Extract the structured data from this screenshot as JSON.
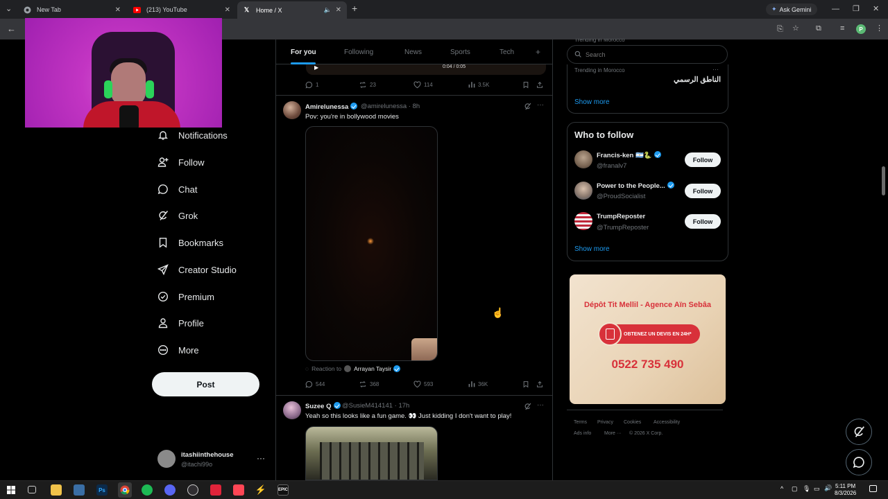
{
  "browser": {
    "tabs": [
      {
        "title": "New Tab",
        "icon": "chrome-icon"
      },
      {
        "title": "(213) YouTube",
        "icon": "youtube-icon"
      },
      {
        "title": "Home / X",
        "icon": "x-logo-icon"
      }
    ],
    "ask_gemini": "Ask Gemini",
    "profile_letter": "P"
  },
  "nav": {
    "items": [
      {
        "label": "Notifications",
        "icon": "bell-icon"
      },
      {
        "label": "Follow",
        "icon": "person-add-icon"
      },
      {
        "label": "Chat",
        "icon": "chat-bubble-icon"
      },
      {
        "label": "Grok",
        "icon": "grok-icon"
      },
      {
        "label": "Bookmarks",
        "icon": "bookmark-icon"
      },
      {
        "label": "Creator Studio",
        "icon": "rocket-icon"
      },
      {
        "label": "Premium",
        "icon": "verified-badge-icon"
      },
      {
        "label": "Profile",
        "icon": "person-icon"
      },
      {
        "label": "More",
        "icon": "more-circle-icon"
      }
    ],
    "post_label": "Post",
    "account": {
      "name": "itashiinthehouse",
      "handle": "@itachi99o"
    }
  },
  "timeline": {
    "tabs": [
      "For you",
      "Following",
      "News",
      "Sports",
      "Tech"
    ],
    "video_time": "0:04 / 0:05",
    "prev_tweet_actions": {
      "replies": "1",
      "reposts": "23",
      "likes": "114",
      "views": "3.5K"
    },
    "tweet1": {
      "name": "Amirelunessa",
      "handle": "@amirelunessa",
      "time": "8h",
      "text": "Pov: you're in bollywood movies",
      "reaction_prefix": "Reaction to",
      "reaction_name": "Arrayan Taysir",
      "actions": {
        "replies": "544",
        "reposts": "368",
        "likes": "593",
        "views": "36K"
      }
    },
    "tweet2": {
      "name": "Suzee Q",
      "handle": "@SusieM414141",
      "time": "17h",
      "text": "Yeah so this looks like a fun game. 👀 Just kidding I don't want to play!"
    }
  },
  "sidebar": {
    "search_placeholder": "Search",
    "trending_partial": "Trending in Morocco",
    "trend": {
      "context": "Trending in Morocco",
      "topic": "الناطق الرسمي"
    },
    "show_more": "Show more",
    "who_to_follow": {
      "title": "Who to follow",
      "accounts": [
        {
          "name": "Francis-ken 🇦🇷🐍",
          "handle": "@franalv7",
          "verified": true
        },
        {
          "name": "Power to the People...",
          "handle": "@ProudSocialist",
          "verified": true
        },
        {
          "name": "TrumpReposter",
          "handle": "@TrumpReposter",
          "verified": false
        }
      ],
      "follow_label": "Follow",
      "show_more": "Show more"
    },
    "ad": {
      "title": "Dépôt Tit Mellil - Agence Aïn Sebâa",
      "cta": "OBTENEZ UN DEVIS EN 24H*",
      "phone": "0522 735 490"
    },
    "footer": {
      "terms": "Terms",
      "privacy": "Privacy",
      "cookies": "Cookies",
      "accessibility": "Accessibility",
      "ads_info": "Ads info",
      "more": "More ···",
      "copyright": "© 2026 X Corp."
    }
  },
  "taskbar": {
    "time": "5:11 PM",
    "date": "8/3/2026"
  }
}
